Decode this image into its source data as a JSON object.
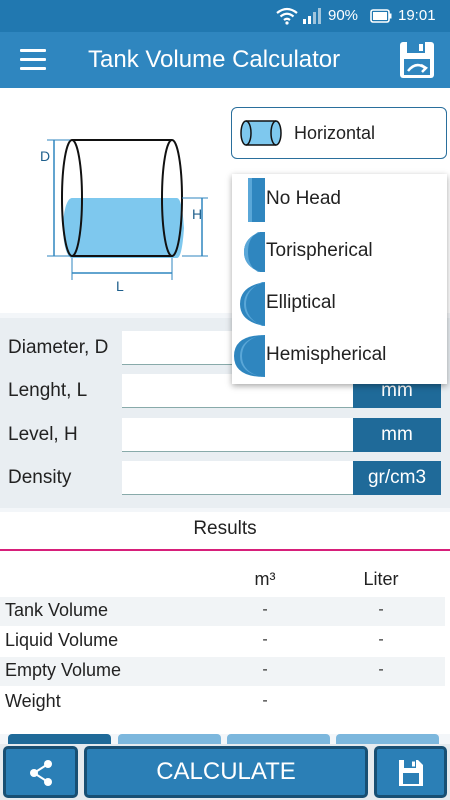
{
  "status_bar": {
    "battery": "90%",
    "time": "19:01"
  },
  "app_bar": {
    "title": "Tank Volume Calculator"
  },
  "diagram": {
    "label_d": "D",
    "label_h": "H",
    "label_l": "L"
  },
  "orientation": {
    "selected": "Horizontal"
  },
  "head_options": [
    {
      "label": "No Head"
    },
    {
      "label": "Torispherical"
    },
    {
      "label": "Elliptical"
    },
    {
      "label": "Hemispherical"
    }
  ],
  "inputs": [
    {
      "label": "Diameter, D",
      "unit": "",
      "value": ""
    },
    {
      "label": "Lenght, L",
      "unit": "mm",
      "value": ""
    },
    {
      "label": "Level, H",
      "unit": "mm",
      "value": ""
    },
    {
      "label": "Density",
      "unit": "gr/cm3",
      "value": ""
    }
  ],
  "results": {
    "title": "Results",
    "columns": [
      "m³",
      "Liter"
    ],
    "rows": [
      {
        "label": "Tank Volume",
        "m3": "-",
        "liter": "-"
      },
      {
        "label": "Liquid Volume",
        "m3": "-",
        "liter": "-"
      },
      {
        "label": "Empty Volume",
        "m3": "-",
        "liter": "-"
      },
      {
        "label": "Weight",
        "m3": "-",
        "liter": ""
      }
    ]
  },
  "bottom_bar": {
    "calculate_label": "CALCULATE"
  },
  "colors": {
    "primary": "#2f86bf",
    "dark": "#1f6a99",
    "accent": "#d71f7a",
    "liquid": "#7ec8ee"
  }
}
